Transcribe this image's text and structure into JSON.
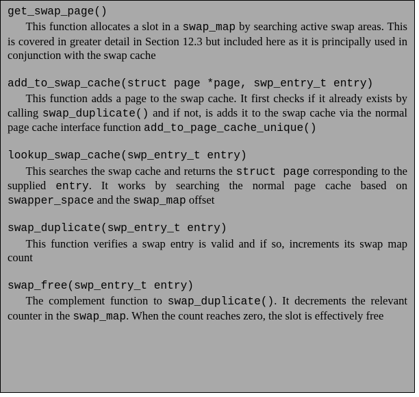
{
  "entries": [
    {
      "sig": "get_swap_page()",
      "desc_parts": [
        {
          "t": "text",
          "v": "This function allocates a slot in a "
        },
        {
          "t": "code",
          "v": "swap_map"
        },
        {
          "t": "text",
          "v": " by searching active swap areas. This is covered in greater detail in Section 12.3 but included here as it is principally used in conjunction with the swap cache"
        }
      ]
    },
    {
      "sig": "add_to_swap_cache(struct page *page, swp_entry_t entry)",
      "desc_parts": [
        {
          "t": "text",
          "v": "This function adds a page to the swap cache.  It first checks if it already exists by calling "
        },
        {
          "t": "code",
          "v": "swap_duplicate()"
        },
        {
          "t": "text",
          "v": " and if not, is adds it to the swap cache via the normal page cache interface function "
        },
        {
          "t": "code",
          "v": "add_to_page_cache_unique()"
        }
      ]
    },
    {
      "sig": "lookup_swap_cache(swp_entry_t entry)",
      "desc_parts": [
        {
          "t": "text",
          "v": "This searches the swap cache and returns the "
        },
        {
          "t": "code",
          "v": "struct page"
        },
        {
          "t": "text",
          "v": " corresponding to the supplied "
        },
        {
          "t": "code",
          "v": "entry"
        },
        {
          "t": "text",
          "v": ". It works by searching the normal page cache based on "
        },
        {
          "t": "code",
          "v": "swapper_space"
        },
        {
          "t": "text",
          "v": " and the "
        },
        {
          "t": "code",
          "v": "swap_map"
        },
        {
          "t": "text",
          "v": " offset"
        }
      ]
    },
    {
      "sig": "swap_duplicate(swp_entry_t entry)",
      "desc_parts": [
        {
          "t": "text",
          "v": "This function verifies a swap entry is valid and if so, increments its swap map count"
        }
      ]
    },
    {
      "sig": "swap_free(swp_entry_t entry)",
      "desc_parts": [
        {
          "t": "text",
          "v": "The complement function to "
        },
        {
          "t": "code",
          "v": "swap_duplicate()"
        },
        {
          "t": "text",
          "v": ". It decrements the relevant counter in the "
        },
        {
          "t": "code",
          "v": "swap_map"
        },
        {
          "t": "text",
          "v": ". When the count reaches zero, the slot is effectively free"
        }
      ]
    }
  ]
}
